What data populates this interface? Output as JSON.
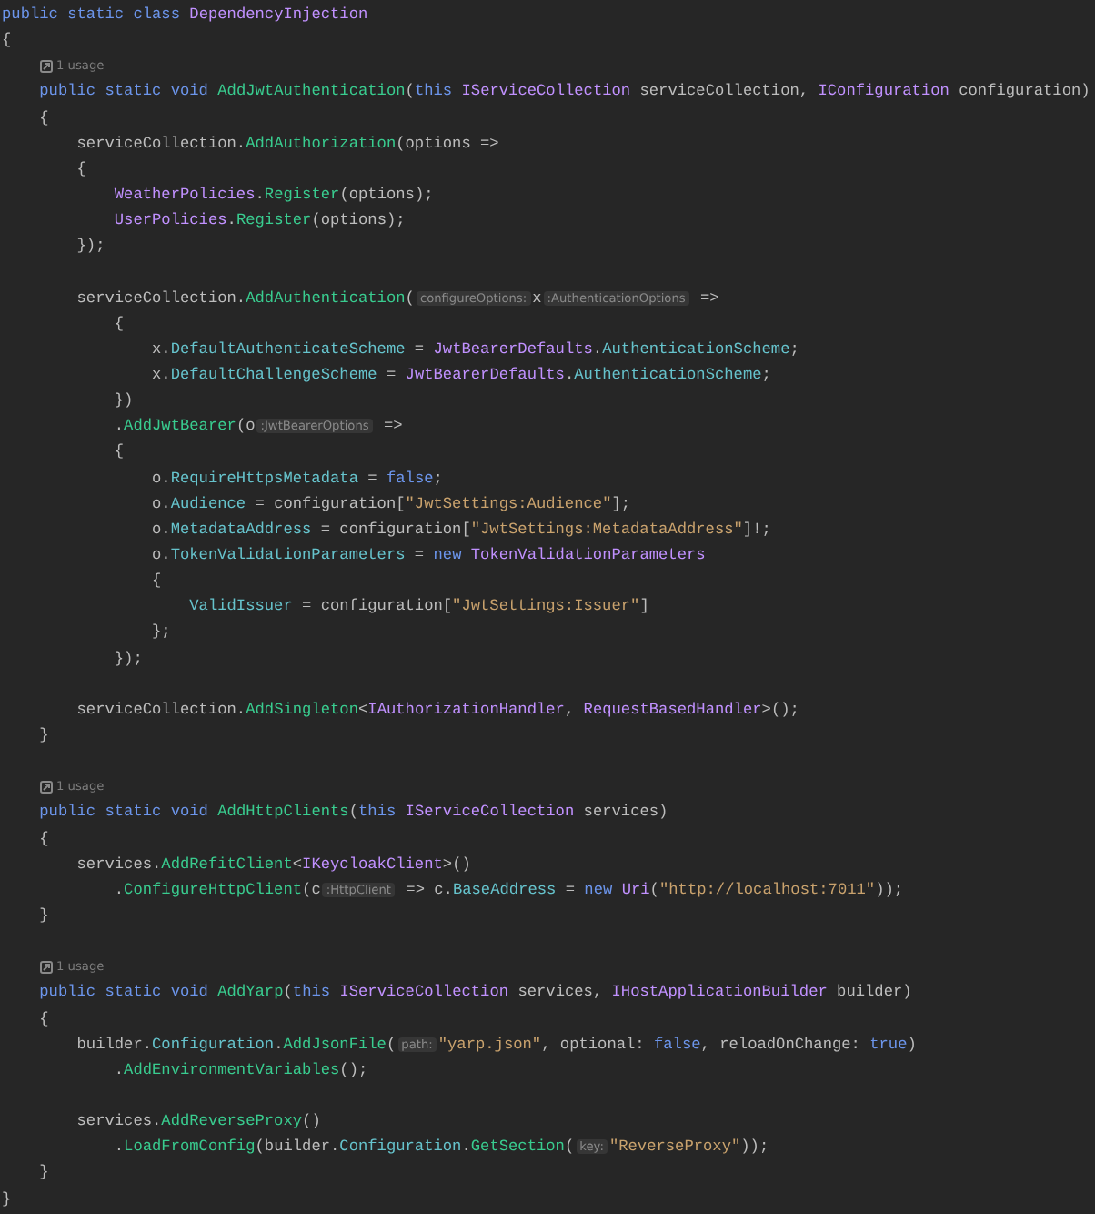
{
  "editor": {
    "lines": [
      {
        "kind": "code",
        "tokens": [
          {
            "kind": "kw",
            "t": "public static class "
          },
          {
            "kind": "type",
            "t": "DependencyInjection"
          }
        ]
      },
      {
        "kind": "code",
        "tokens": [
          {
            "kind": "plain",
            "t": "{"
          }
        ]
      },
      {
        "kind": "usage",
        "text": "1 usage"
      },
      {
        "kind": "code",
        "tokens": [
          {
            "kind": "kw",
            "t": "    public static void "
          },
          {
            "kind": "method",
            "t": "AddJwtAuthentication"
          },
          {
            "kind": "plain",
            "t": "("
          },
          {
            "kind": "kw",
            "t": "this "
          },
          {
            "kind": "type",
            "t": "IServiceCollection"
          },
          {
            "kind": "plain",
            "t": " serviceCollection, "
          },
          {
            "kind": "type",
            "t": "IConfiguration"
          },
          {
            "kind": "plain",
            "t": " configuration)"
          }
        ]
      },
      {
        "kind": "code",
        "tokens": [
          {
            "kind": "plain",
            "t": "    {"
          }
        ]
      },
      {
        "kind": "code",
        "tokens": [
          {
            "kind": "plain",
            "t": "        serviceCollection."
          },
          {
            "kind": "method",
            "t": "AddAuthorization"
          },
          {
            "kind": "plain",
            "t": "(options =>"
          }
        ]
      },
      {
        "kind": "code",
        "tokens": [
          {
            "kind": "plain",
            "t": "        {"
          }
        ]
      },
      {
        "kind": "code",
        "tokens": [
          {
            "kind": "type",
            "t": "            WeatherPolicies"
          },
          {
            "kind": "plain",
            "t": "."
          },
          {
            "kind": "method",
            "t": "Register"
          },
          {
            "kind": "plain",
            "t": "(options);"
          }
        ]
      },
      {
        "kind": "code",
        "tokens": [
          {
            "kind": "type",
            "t": "            UserPolicies"
          },
          {
            "kind": "plain",
            "t": "."
          },
          {
            "kind": "method",
            "t": "Register"
          },
          {
            "kind": "plain",
            "t": "(options);"
          }
        ]
      },
      {
        "kind": "code",
        "tokens": [
          {
            "kind": "plain",
            "t": "        });"
          }
        ]
      },
      {
        "kind": "blank"
      },
      {
        "kind": "code",
        "tokens": [
          {
            "kind": "plain",
            "t": "        serviceCollection."
          },
          {
            "kind": "method",
            "t": "AddAuthentication"
          },
          {
            "kind": "plain",
            "t": "("
          },
          {
            "kind": "hint",
            "t": "configureOptions:"
          },
          {
            "kind": "plain",
            "t": "x"
          },
          {
            "kind": "hint",
            "t": ":AuthenticationOptions"
          },
          {
            "kind": "plain",
            "t": " =>"
          }
        ]
      },
      {
        "kind": "code",
        "tokens": [
          {
            "kind": "plain",
            "t": "            {"
          }
        ]
      },
      {
        "kind": "code",
        "tokens": [
          {
            "kind": "plain",
            "t": "                x."
          },
          {
            "kind": "prop",
            "t": "DefaultAuthenticateScheme"
          },
          {
            "kind": "plain",
            "t": " = "
          },
          {
            "kind": "type",
            "t": "JwtBearerDefaults"
          },
          {
            "kind": "plain",
            "t": "."
          },
          {
            "kind": "prop",
            "t": "AuthenticationScheme"
          },
          {
            "kind": "plain",
            "t": ";"
          }
        ]
      },
      {
        "kind": "code",
        "tokens": [
          {
            "kind": "plain",
            "t": "                x."
          },
          {
            "kind": "prop",
            "t": "DefaultChallengeScheme"
          },
          {
            "kind": "plain",
            "t": " = "
          },
          {
            "kind": "type",
            "t": "JwtBearerDefaults"
          },
          {
            "kind": "plain",
            "t": "."
          },
          {
            "kind": "prop",
            "t": "AuthenticationScheme"
          },
          {
            "kind": "plain",
            "t": ";"
          }
        ]
      },
      {
        "kind": "code",
        "tokens": [
          {
            "kind": "plain",
            "t": "            })"
          }
        ]
      },
      {
        "kind": "code",
        "tokens": [
          {
            "kind": "plain",
            "t": "            ."
          },
          {
            "kind": "method",
            "t": "AddJwtBearer"
          },
          {
            "kind": "plain",
            "t": "(o"
          },
          {
            "kind": "hint",
            "t": ":JwtBearerOptions"
          },
          {
            "kind": "plain",
            "t": " =>"
          }
        ]
      },
      {
        "kind": "code",
        "tokens": [
          {
            "kind": "plain",
            "t": "            {"
          }
        ]
      },
      {
        "kind": "code",
        "tokens": [
          {
            "kind": "plain",
            "t": "                o."
          },
          {
            "kind": "prop",
            "t": "RequireHttpsMetadata"
          },
          {
            "kind": "plain",
            "t": " = "
          },
          {
            "kind": "kw",
            "t": "false"
          },
          {
            "kind": "plain",
            "t": ";"
          }
        ]
      },
      {
        "kind": "code",
        "tokens": [
          {
            "kind": "plain",
            "t": "                o."
          },
          {
            "kind": "prop",
            "t": "Audience"
          },
          {
            "kind": "plain",
            "t": " = configuration["
          },
          {
            "kind": "str",
            "t": "\"JwtSettings:Audience\""
          },
          {
            "kind": "plain",
            "t": "];"
          }
        ]
      },
      {
        "kind": "code",
        "tokens": [
          {
            "kind": "plain",
            "t": "                o."
          },
          {
            "kind": "prop",
            "t": "MetadataAddress"
          },
          {
            "kind": "plain",
            "t": " = configuration["
          },
          {
            "kind": "str",
            "t": "\"JwtSettings:MetadataAddress\""
          },
          {
            "kind": "plain",
            "t": "]!;"
          }
        ]
      },
      {
        "kind": "code",
        "tokens": [
          {
            "kind": "plain",
            "t": "                o."
          },
          {
            "kind": "prop",
            "t": "TokenValidationParameters"
          },
          {
            "kind": "plain",
            "t": " = "
          },
          {
            "kind": "kw",
            "t": "new "
          },
          {
            "kind": "type",
            "t": "TokenValidationParameters"
          }
        ]
      },
      {
        "kind": "code",
        "tokens": [
          {
            "kind": "plain",
            "t": "                {"
          }
        ]
      },
      {
        "kind": "code",
        "tokens": [
          {
            "kind": "prop",
            "t": "                    ValidIssuer"
          },
          {
            "kind": "plain",
            "t": " = configuration["
          },
          {
            "kind": "str",
            "t": "\"JwtSettings:Issuer\""
          },
          {
            "kind": "plain",
            "t": "]"
          }
        ]
      },
      {
        "kind": "code",
        "tokens": [
          {
            "kind": "plain",
            "t": "                };"
          }
        ]
      },
      {
        "kind": "code",
        "tokens": [
          {
            "kind": "plain",
            "t": "            });"
          }
        ]
      },
      {
        "kind": "blank"
      },
      {
        "kind": "code",
        "tokens": [
          {
            "kind": "plain",
            "t": "        serviceCollection."
          },
          {
            "kind": "method",
            "t": "AddSingleton"
          },
          {
            "kind": "plain",
            "t": "<"
          },
          {
            "kind": "type",
            "t": "IAuthorizationHandler"
          },
          {
            "kind": "plain",
            "t": ", "
          },
          {
            "kind": "type",
            "t": "RequestBasedHandler"
          },
          {
            "kind": "plain",
            "t": ">();"
          }
        ]
      },
      {
        "kind": "code",
        "tokens": [
          {
            "kind": "plain",
            "t": "    }"
          }
        ]
      },
      {
        "kind": "blank"
      },
      {
        "kind": "usage",
        "text": "1 usage"
      },
      {
        "kind": "code",
        "tokens": [
          {
            "kind": "kw",
            "t": "    public static void "
          },
          {
            "kind": "method",
            "t": "AddHttpClients"
          },
          {
            "kind": "plain",
            "t": "("
          },
          {
            "kind": "kw",
            "t": "this "
          },
          {
            "kind": "type",
            "t": "IServiceCollection"
          },
          {
            "kind": "plain",
            "t": " services)"
          }
        ]
      },
      {
        "kind": "code",
        "tokens": [
          {
            "kind": "plain",
            "t": "    {"
          }
        ]
      },
      {
        "kind": "code",
        "tokens": [
          {
            "kind": "plain",
            "t": "        services."
          },
          {
            "kind": "method",
            "t": "AddRefitClient"
          },
          {
            "kind": "plain",
            "t": "<"
          },
          {
            "kind": "type",
            "t": "IKeycloakClient"
          },
          {
            "kind": "plain",
            "t": ">()"
          }
        ]
      },
      {
        "kind": "code",
        "tokens": [
          {
            "kind": "plain",
            "t": "            ."
          },
          {
            "kind": "method",
            "t": "ConfigureHttpClient"
          },
          {
            "kind": "plain",
            "t": "(c"
          },
          {
            "kind": "hint",
            "t": ":HttpClient"
          },
          {
            "kind": "plain",
            "t": " => c."
          },
          {
            "kind": "prop",
            "t": "BaseAddress"
          },
          {
            "kind": "plain",
            "t": " = "
          },
          {
            "kind": "kw",
            "t": "new "
          },
          {
            "kind": "type",
            "t": "Uri"
          },
          {
            "kind": "plain",
            "t": "("
          },
          {
            "kind": "str",
            "t": "\"http://localhost:7011\""
          },
          {
            "kind": "plain",
            "t": "));"
          }
        ]
      },
      {
        "kind": "code",
        "tokens": [
          {
            "kind": "plain",
            "t": "    }"
          }
        ]
      },
      {
        "kind": "blank"
      },
      {
        "kind": "usage",
        "text": "1 usage"
      },
      {
        "kind": "code",
        "tokens": [
          {
            "kind": "kw",
            "t": "    public static void "
          },
          {
            "kind": "method",
            "t": "AddYarp"
          },
          {
            "kind": "plain",
            "t": "("
          },
          {
            "kind": "kw",
            "t": "this "
          },
          {
            "kind": "type",
            "t": "IServiceCollection"
          },
          {
            "kind": "plain",
            "t": " services, "
          },
          {
            "kind": "type",
            "t": "IHostApplicationBuilder"
          },
          {
            "kind": "plain",
            "t": " builder)"
          }
        ]
      },
      {
        "kind": "code",
        "tokens": [
          {
            "kind": "plain",
            "t": "    {"
          }
        ]
      },
      {
        "kind": "code",
        "tokens": [
          {
            "kind": "plain",
            "t": "        builder."
          },
          {
            "kind": "prop",
            "t": "Configuration"
          },
          {
            "kind": "plain",
            "t": "."
          },
          {
            "kind": "method",
            "t": "AddJsonFile"
          },
          {
            "kind": "plain",
            "t": "("
          },
          {
            "kind": "hint",
            "t": "path:"
          },
          {
            "kind": "str",
            "t": "\"yarp.json\""
          },
          {
            "kind": "plain",
            "t": ", optional: "
          },
          {
            "kind": "kw",
            "t": "false"
          },
          {
            "kind": "plain",
            "t": ", reloadOnChange: "
          },
          {
            "kind": "kw",
            "t": "true"
          },
          {
            "kind": "plain",
            "t": ")"
          }
        ]
      },
      {
        "kind": "code",
        "tokens": [
          {
            "kind": "plain",
            "t": "            ."
          },
          {
            "kind": "method",
            "t": "AddEnvironmentVariables"
          },
          {
            "kind": "plain",
            "t": "();"
          }
        ]
      },
      {
        "kind": "blank"
      },
      {
        "kind": "code",
        "tokens": [
          {
            "kind": "plain",
            "t": "        services."
          },
          {
            "kind": "method",
            "t": "AddReverseProxy"
          },
          {
            "kind": "plain",
            "t": "()"
          }
        ]
      },
      {
        "kind": "code",
        "tokens": [
          {
            "kind": "plain",
            "t": "            ."
          },
          {
            "kind": "method",
            "t": "LoadFromConfig"
          },
          {
            "kind": "plain",
            "t": "(builder."
          },
          {
            "kind": "prop",
            "t": "Configuration"
          },
          {
            "kind": "plain",
            "t": "."
          },
          {
            "kind": "method",
            "t": "GetSection"
          },
          {
            "kind": "plain",
            "t": "("
          },
          {
            "kind": "hint",
            "t": "key:"
          },
          {
            "kind": "str",
            "t": "\"ReverseProxy\""
          },
          {
            "kind": "plain",
            "t": "));"
          }
        ]
      },
      {
        "kind": "code",
        "tokens": [
          {
            "kind": "plain",
            "t": "    }"
          }
        ]
      },
      {
        "kind": "code",
        "tokens": [
          {
            "kind": "plain",
            "t": "}"
          }
        ]
      }
    ]
  }
}
